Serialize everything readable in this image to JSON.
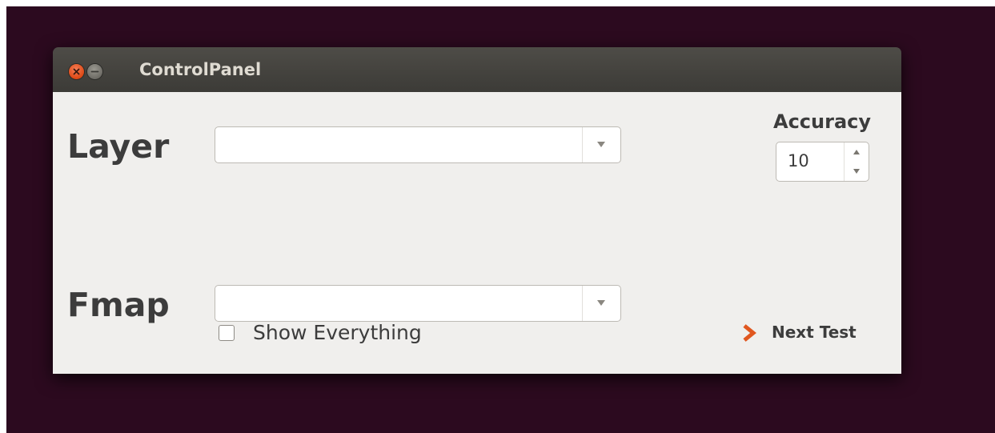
{
  "window": {
    "title": "ControlPanel",
    "close_icon": "close-icon",
    "minimize_icon": "minimize-icon"
  },
  "layer": {
    "label": "Layer",
    "value": "",
    "dropdown_icon": "dropdown-arrow-icon"
  },
  "fmap": {
    "label": "Fmap",
    "value": "",
    "dropdown_icon": "dropdown-arrow-icon"
  },
  "accuracy": {
    "label": "Accuracy",
    "value": "10",
    "up_icon": "spin-up-icon",
    "down_icon": "spin-down-icon"
  },
  "show_everything": {
    "label": "Show Everything",
    "checked": false
  },
  "next_test": {
    "label": "Next Test",
    "icon": "chevron-right-icon"
  },
  "colors": {
    "desktop": "#2c0a1f",
    "titlebar": "#3c3b37",
    "content_bg": "#f0efed",
    "close_button": "#dd4814",
    "next_icon": "#e0571f"
  }
}
